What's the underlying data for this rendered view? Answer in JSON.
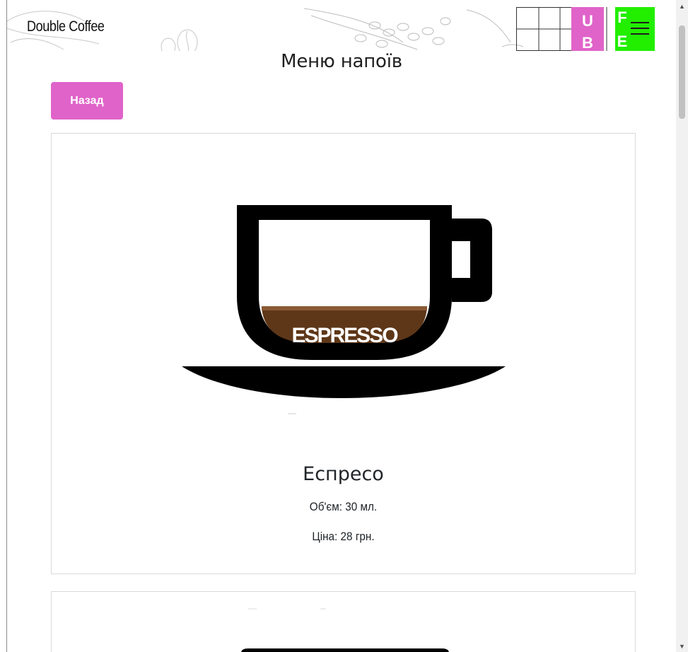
{
  "header": {
    "brand": "Double Coffee",
    "logo_letters": [
      "U",
      "B",
      "F",
      "E"
    ],
    "logo_colors": {
      "pink": "#e063c9",
      "green": "#22ee00"
    }
  },
  "page": {
    "title": "Меню напоїв",
    "back_label": "Назад"
  },
  "products": [
    {
      "name": "Еспресо",
      "image_label": "ESPRESSO",
      "volume": "Об'єм: 30 мл.",
      "price": "Ціна: 28 грн."
    }
  ],
  "colors": {
    "accent": "#e063c9",
    "coffee": "#5e3718",
    "crema": "#8a5a35"
  },
  "icons": {
    "menu": "hamburger-icon",
    "scroll_up": "arrow-up-icon",
    "scroll_down": "arrow-down-icon"
  }
}
